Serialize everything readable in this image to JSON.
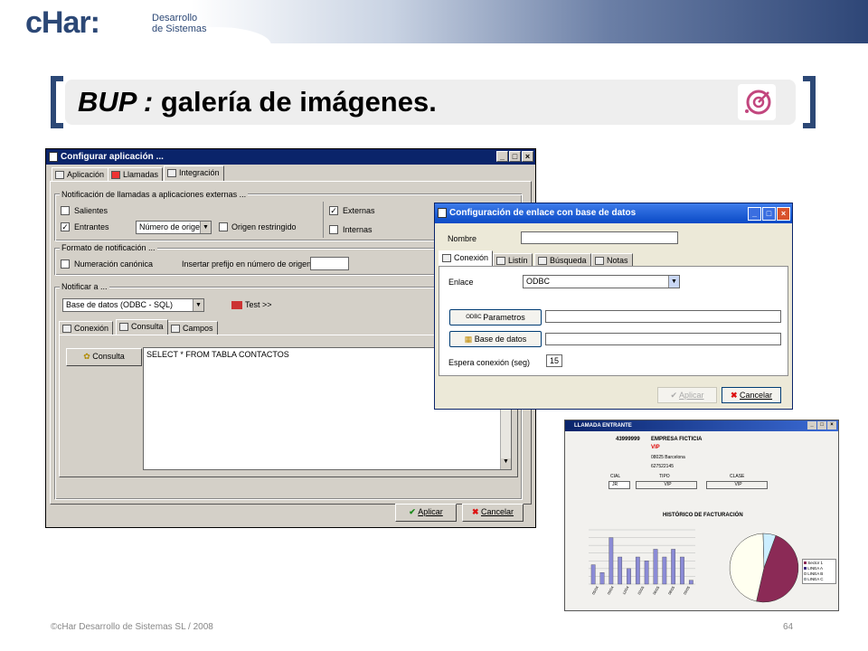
{
  "slide": {
    "title_strong": "BUP :",
    "title_rest": " galería de imágenes.",
    "footer": "©cHar Desarrollo de Sistemas SL / 2008",
    "page_number": "64",
    "logo": {
      "text": "cHar:",
      "sub1": "Desarrollo",
      "sub2": "de Sistemas"
    },
    "colors": {
      "brand": "#2c4876",
      "titlebar": "#0a246a",
      "titlebar_xp": "#2a5bd6"
    }
  },
  "config_window": {
    "title": "Configurar aplicación ...",
    "tabs": [
      "Aplicación",
      "Llamadas",
      "Integración"
    ],
    "group_notif": "Notificación de llamadas a aplicaciones externas ...",
    "salientes": "Salientes",
    "entrantes": "Entrantes",
    "origen_select": "Número de origen",
    "origen_restringido": "Origen restringido",
    "externas": "Externas",
    "internas": "Internas",
    "group_formato": "Formato de notificación ...",
    "numeracion": "Numeración canónica",
    "prefijo_label": "Insertar prefijo en número de origen",
    "prefijo_value": "",
    "group_notificar": "Notificar a ...",
    "notificar_select": "Base de datos (ODBC - SQL)",
    "test": "Test >>",
    "subtabs": [
      "Conexión",
      "Consulta",
      "Campos"
    ],
    "consulta_button": "Consulta",
    "query": "SELECT * FROM TABLA CONTACTOS",
    "aplicar": "Aplicar",
    "cancelar": "Cancelar"
  },
  "db_window": {
    "title": "Configuración de enlace con base de datos",
    "nombre_label": "Nombre",
    "nombre_value": "",
    "tabs": [
      "Conexión",
      "Listín",
      "Búsqueda",
      "Notas"
    ],
    "enlace_label": "Enlace",
    "enlace_value": "ODBC",
    "parametros": "Parametros",
    "parametros_badge": "ODBC",
    "parametros_value": "",
    "base_datos": "Base de datos",
    "base_datos_value": "",
    "espera_label": "Espera conexión (seg)",
    "espera_value": "15",
    "aplicar": "Aplicar",
    "cancelar": "Cancelar"
  },
  "call_window": {
    "title": "LLAMADA ENTRANTE",
    "number": "43999999",
    "company": "EMPRESA FICTICIA",
    "vip": "VIP",
    "address": "08025 Barcelona",
    "phone": "627522145",
    "col_cial": "CIAL",
    "col_tipo": "TIPO",
    "col_clase": "CLASE",
    "cial_value": "JR",
    "tipo_value": "VIP",
    "clase_value": "VIP",
    "chart_title": "HISTÓRICO DE FACTURACIÓN",
    "legend": [
      "Sector 1",
      "LINEA A",
      "LINEA B",
      "LINEA C"
    ],
    "colors": {
      "bar": "#8b8bd6",
      "pie_main": "#8b2a56",
      "pie_light": "#fffff0",
      "pie_blue": "#cceeff"
    }
  },
  "chart_data": [
    {
      "type": "bar",
      "title": "HISTÓRICO DE FACTURACIÓN",
      "values": [
        5,
        3,
        12,
        7,
        4,
        7,
        6,
        9,
        7,
        9,
        7,
        1
      ],
      "x_tick_labels": [
        "05/04",
        "09/04",
        "12/04",
        "03/05",
        "06/05",
        "08/05",
        "09/05"
      ]
    },
    {
      "type": "pie",
      "labels": [
        "Sector 1",
        "LINEA A",
        "LINEA B",
        "LINEA C"
      ],
      "values": [
        48,
        0,
        46,
        6
      ]
    }
  ]
}
